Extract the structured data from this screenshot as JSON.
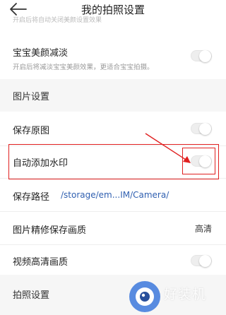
{
  "header": {
    "title": "我的拍照设置"
  },
  "clipped_top_desc": "开启后将自动关闭美颜设置效果",
  "baby_beauty": {
    "label": "宝宝美颜减淡",
    "desc": "开启后将减淡宝宝美颜效果，更适合宝宝拍摄。",
    "enabled": false
  },
  "sections": {
    "image_settings": "图片设置",
    "photo_settings": "拍照设置"
  },
  "save_original": {
    "label": "保存原图",
    "enabled": false
  },
  "auto_watermark": {
    "label": "自动添加水印",
    "enabled": false
  },
  "save_path": {
    "label": "保存路径",
    "value": "/storage/em...IM/Camera/"
  },
  "retouch_quality": {
    "label": "图片精修保存画质",
    "value": "高清"
  },
  "video_hd": {
    "label": "视频高清画质",
    "enabled": false
  },
  "watermark_logo": {
    "text": "好装机"
  },
  "colors": {
    "annotation": "#e02020",
    "path_link": "#2f5fb0",
    "section_bg": "#f6f6f6"
  }
}
